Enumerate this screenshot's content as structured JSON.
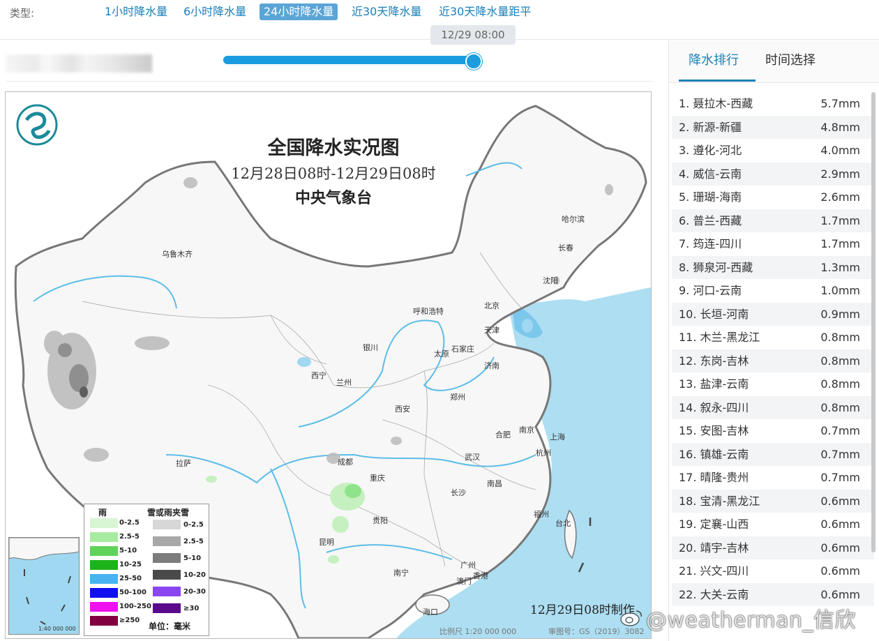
{
  "type_bar": {
    "label": "类型:",
    "options": [
      "1小时降水量",
      "6小时降水量",
      "24小时降水量",
      "近30天降水量",
      "近30天降水量距平"
    ],
    "active_index": 2
  },
  "slider": {
    "tooltip": "12/29 08:00",
    "value_fraction": 1.0
  },
  "map": {
    "title": "全国降水实况图",
    "period": "12月28日08时-12月29日08时",
    "org": "中央气象台",
    "made_time": "12月29日08时制作",
    "scale": "比例尺 1:20 000 000",
    "map_no": "审图号：GS（2019）3082号",
    "cities": [
      "乌鲁木齐",
      "哈尔滨",
      "长春",
      "沈阳",
      "呼和浩特",
      "北京",
      "天津",
      "银川",
      "太原",
      "石家庄",
      "西宁",
      "兰州",
      "济南",
      "郑州",
      "西安",
      "南京",
      "合肥",
      "上海",
      "成都",
      "武汉",
      "杭州",
      "重庆",
      "长沙",
      "南昌",
      "拉萨",
      "贵阳",
      "福州",
      "台北",
      "昆明",
      "广州",
      "南宁",
      "香港",
      "澳门",
      "海口"
    ],
    "legend": {
      "rain_title": "雨",
      "snow_title": "雪或雨夹雪",
      "rain": [
        "0-2.5",
        "2.5-5",
        "5-10",
        "10-25",
        "25-50",
        "50-100",
        "100-250",
        "≥250"
      ],
      "snow": [
        "0-2.5",
        "2.5-5",
        "5-10",
        "10-20",
        "20-30",
        "≥30"
      ],
      "rain_colors": [
        "#d8f5d4",
        "#a6eca0",
        "#5fd35a",
        "#1db31a",
        "#47b3f0",
        "#1010f0",
        "#f010f0",
        "#800040"
      ],
      "snow_colors": [
        "#d7d7d7",
        "#a8a8a8",
        "#7c7c7c",
        "#4a4a4a",
        "#8a46f0",
        "#5a0a8a"
      ],
      "unit": "单位：毫米"
    },
    "inset_scale": "1:40 000 000"
  },
  "right_panel": {
    "tabs": [
      "降水排行",
      "时间选择"
    ],
    "active_tab": 0,
    "ranking": [
      {
        "name": "1. 聂拉木-西藏",
        "value": "5.7mm"
      },
      {
        "name": "2. 新源-新疆",
        "value": "4.8mm"
      },
      {
        "name": "3. 遵化-河北",
        "value": "4.0mm"
      },
      {
        "name": "4. 威信-云南",
        "value": "2.9mm"
      },
      {
        "name": "5. 珊瑚-海南",
        "value": "2.6mm"
      },
      {
        "name": "6. 普兰-西藏",
        "value": "1.7mm"
      },
      {
        "name": "7. 筠连-四川",
        "value": "1.7mm"
      },
      {
        "name": "8. 狮泉河-西藏",
        "value": "1.3mm"
      },
      {
        "name": "9. 河口-云南",
        "value": "1.0mm"
      },
      {
        "name": "10. 长垣-河南",
        "value": "0.9mm"
      },
      {
        "name": "11. 木兰-黑龙江",
        "value": "0.8mm"
      },
      {
        "name": "12. 东岗-吉林",
        "value": "0.8mm"
      },
      {
        "name": "13. 盐津-云南",
        "value": "0.8mm"
      },
      {
        "name": "14. 叙永-四川",
        "value": "0.8mm"
      },
      {
        "name": "15. 安图-吉林",
        "value": "0.7mm"
      },
      {
        "name": "16. 镇雄-云南",
        "value": "0.7mm"
      },
      {
        "name": "17. 晴隆-贵州",
        "value": "0.7mm"
      },
      {
        "name": "18. 宝清-黑龙江",
        "value": "0.6mm"
      },
      {
        "name": "19. 定襄-山西",
        "value": "0.6mm"
      },
      {
        "name": "20. 靖宇-吉林",
        "value": "0.6mm"
      },
      {
        "name": "21. 兴文-四川",
        "value": "0.6mm"
      },
      {
        "name": "22. 大关-云南",
        "value": "0.6mm"
      }
    ]
  },
  "watermark": "@weatherman_信欣"
}
